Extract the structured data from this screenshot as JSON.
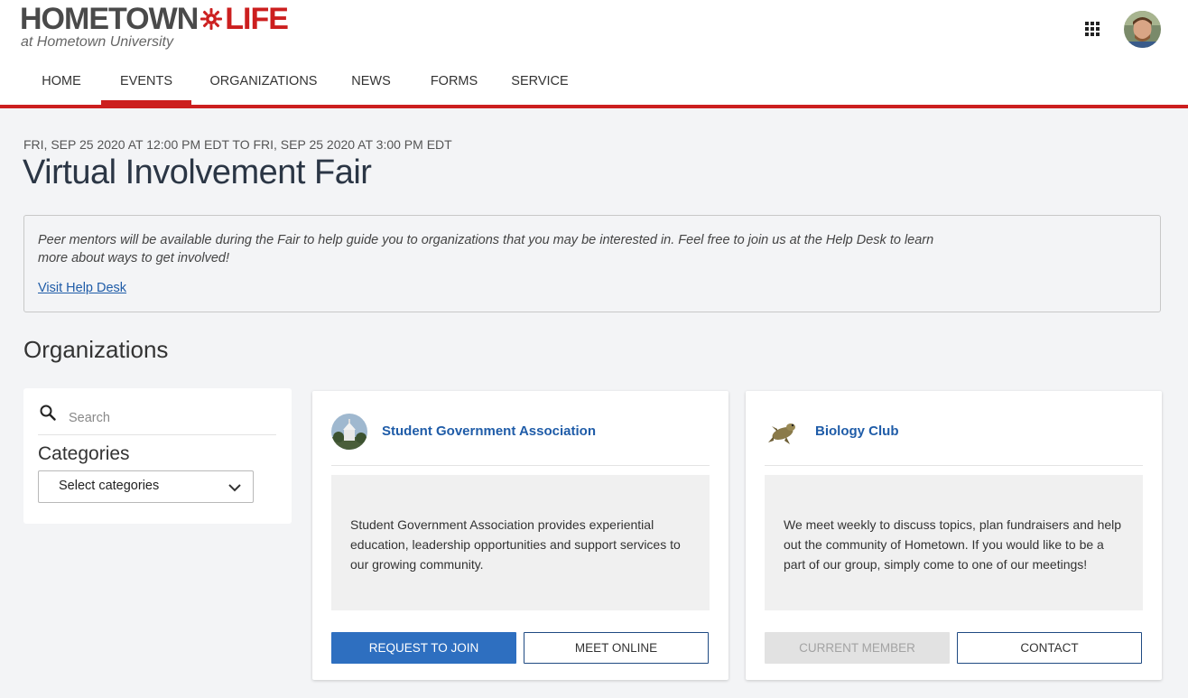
{
  "brand": {
    "name_part1": "HOMETOWN",
    "name_part2": "LIFE",
    "subtitle": "at Hometown University",
    "accent_color": "#cc1f1f"
  },
  "header_icons": {
    "apps": "grid-apps-icon",
    "avatar": "user-avatar"
  },
  "nav": {
    "items": [
      {
        "label": "HOME",
        "active": false
      },
      {
        "label": "EVENTS",
        "active": true
      },
      {
        "label": "ORGANIZATIONS",
        "active": false
      },
      {
        "label": "NEWS",
        "active": false
      },
      {
        "label": "FORMS",
        "active": false
      },
      {
        "label": "SERVICE",
        "active": false
      }
    ]
  },
  "event": {
    "date_range": "FRI, SEP 25 2020 AT 12:00 PM EDT TO FRI, SEP 25 2020 AT 3:00 PM EDT",
    "title": "Virtual Involvement Fair",
    "info_text": "Peer mentors will be available during the Fair to help guide you to organizations that you may be interested in. Feel free to join us at the Help Desk to learn more about ways to get involved!",
    "info_link": "Visit Help Desk"
  },
  "organizations": {
    "section_title": "Organizations",
    "filter": {
      "search_placeholder": "Search",
      "categories_label": "Categories",
      "categories_select": "Select categories"
    },
    "cards": [
      {
        "name": "Student Government Association",
        "description": "Student Government Association provides experiential education, leadership opportunities and support services to our growing community.",
        "primary_button": "REQUEST TO JOIN",
        "secondary_button": "MEET ONLINE"
      },
      {
        "name": "Biology Club",
        "description": "We meet weekly to discuss topics, plan fundraisers and help out the community of Hometown. If you would like to be a part of our group, simply come to one of our meetings!",
        "primary_button": "CURRENT MEMBER",
        "secondary_button": "CONTACT"
      }
    ]
  },
  "colors": {
    "primary_button": "#2e6fc0",
    "link": "#1f5ca8",
    "background": "#f3f4f6"
  }
}
